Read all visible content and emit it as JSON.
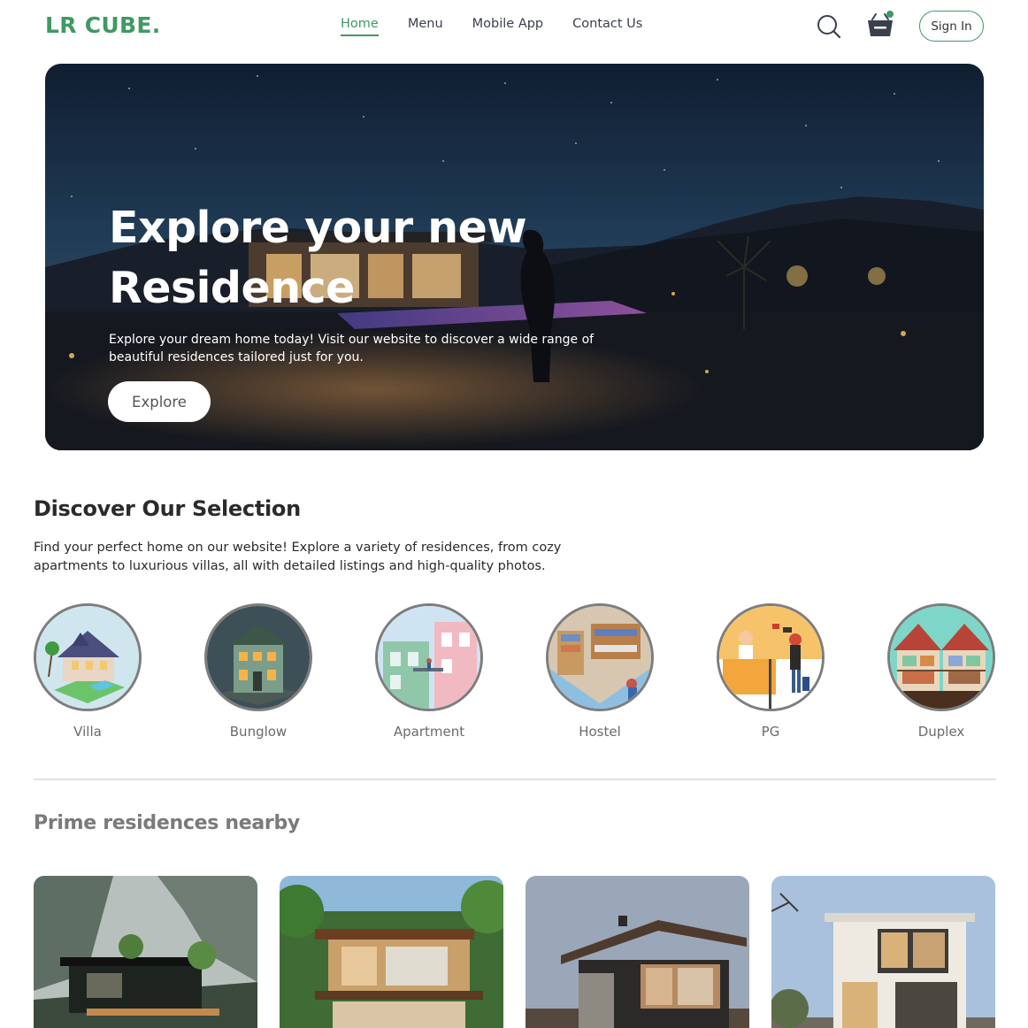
{
  "brand": {
    "logo": "LR CUBE.",
    "accent": "#3e9a63"
  },
  "nav": {
    "links": [
      {
        "label": "Home",
        "active": true
      },
      {
        "label": "Menu",
        "active": false
      },
      {
        "label": "Mobile App",
        "active": false
      },
      {
        "label": "Contact Us",
        "active": false
      }
    ],
    "icons": [
      "search-icon",
      "basket-icon"
    ],
    "signin_label": "Sign In"
  },
  "hero": {
    "title_line1": "Explore your new",
    "title_line2": "Residence",
    "subtitle": "Explore your dream home today! Visit our website to discover a wide range of beautiful residences tailored just for you.",
    "button_label": "Explore"
  },
  "discover": {
    "title": "Discover Our Selection",
    "description": "Find your perfect home on our website! Explore a variety of residences, from cozy apartments to luxurious villas, all with detailed listings and high-quality photos.",
    "categories": [
      {
        "label": "Villa"
      },
      {
        "label": "Bunglow"
      },
      {
        "label": "Apartment"
      },
      {
        "label": "Hostel"
      },
      {
        "label": "PG"
      },
      {
        "label": "Duplex"
      }
    ]
  },
  "prime": {
    "title": "Prime residences nearby"
  }
}
